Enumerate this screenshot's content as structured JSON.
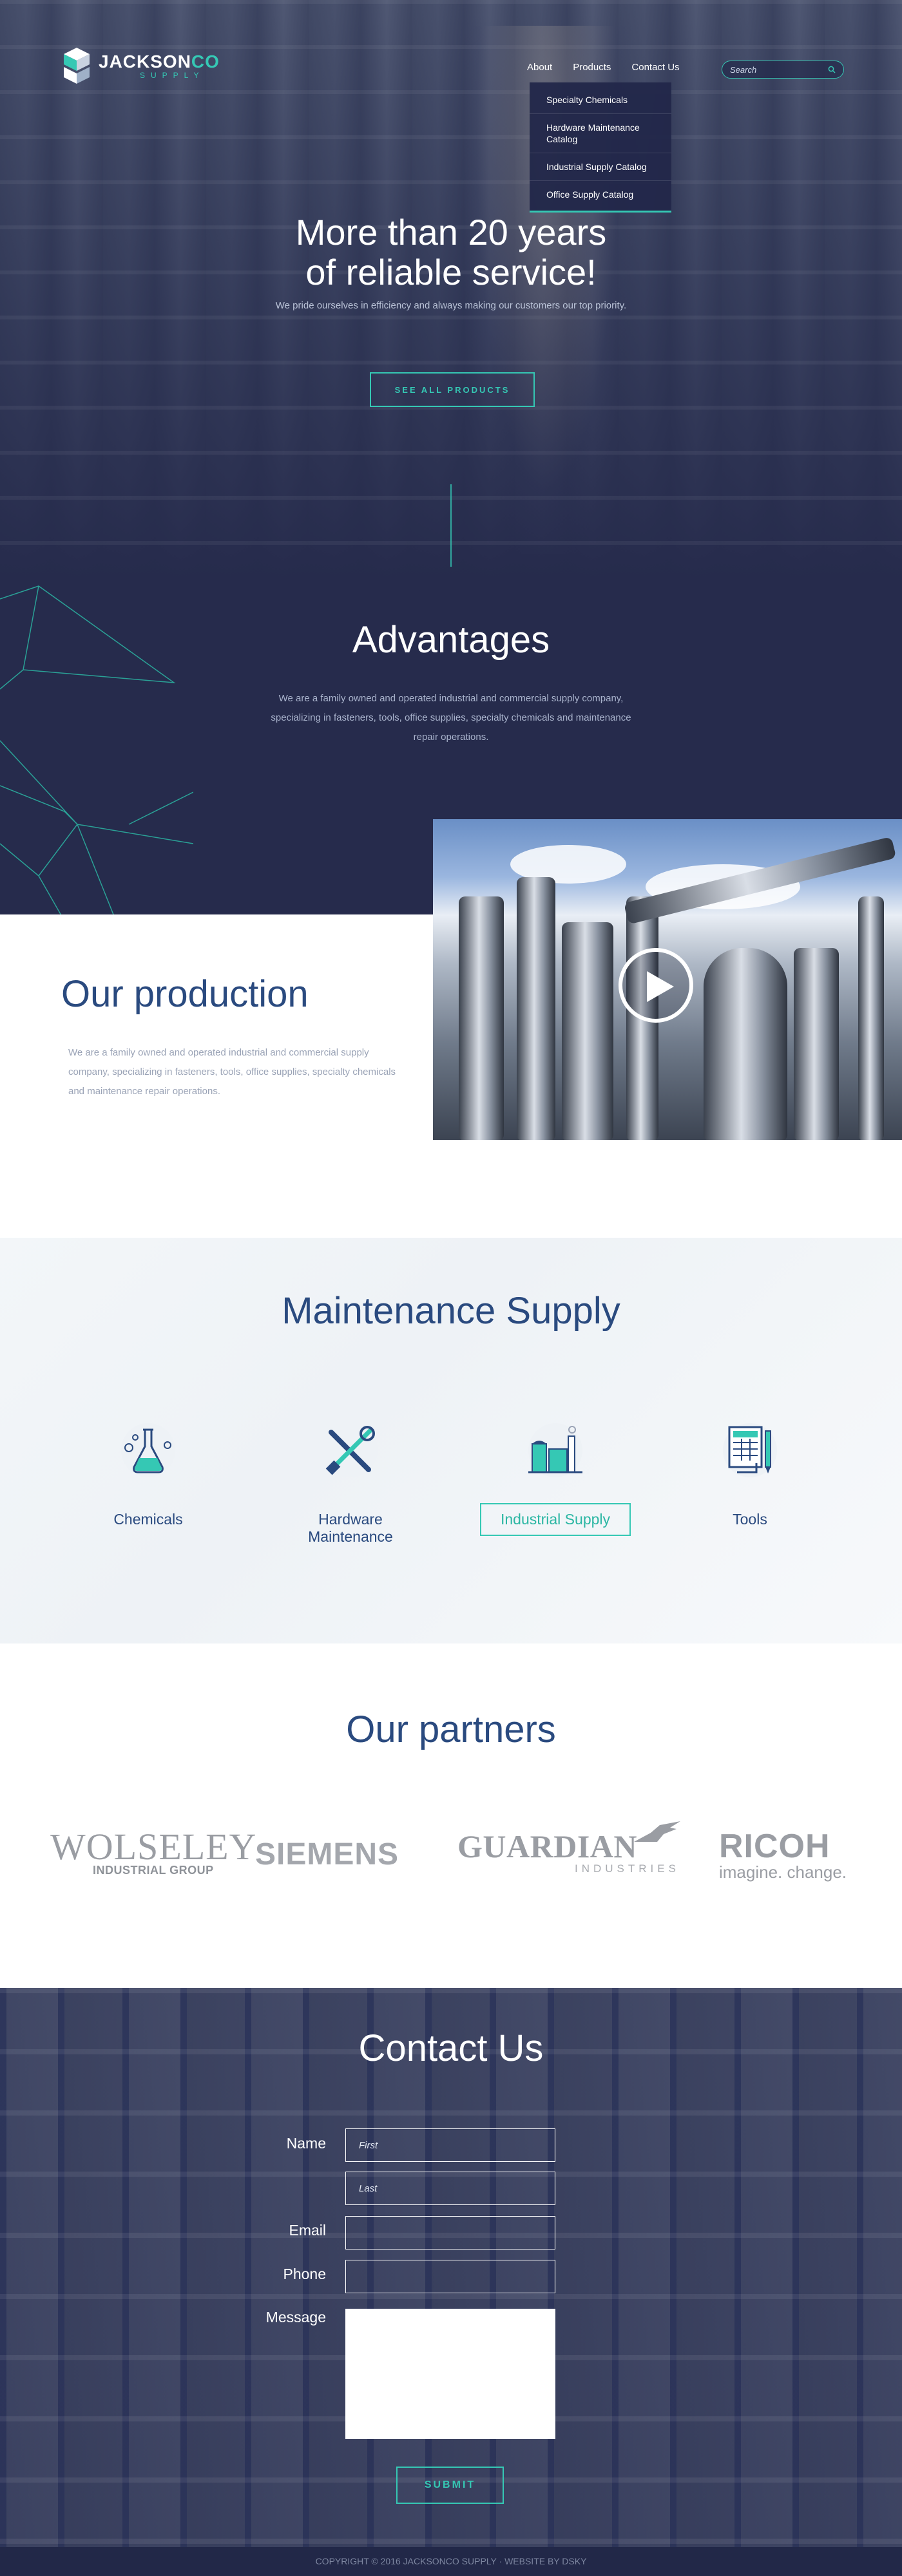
{
  "brand": {
    "name_main": "JACKSON",
    "name_accent": "CO",
    "sub": "SUPPLY"
  },
  "nav": {
    "items": [
      "About",
      "Products",
      "Contact Us"
    ],
    "search_placeholder": "Search"
  },
  "dropdown": {
    "items": [
      "Specialty Chemicals",
      "Hardware Maintenance Catalog",
      "Industrial Supply Catalog",
      "Office Supply Catalog"
    ]
  },
  "hero": {
    "title_line1": "More than 20 years",
    "title_line2": "of reliable service!",
    "subtitle": "We pride ourselves in efficiency and always making our customers our top priority.",
    "button": "SEE ALL PRODUCTS"
  },
  "advantages": {
    "title": "Advantages",
    "text": "We are a family owned and operated industrial and commercial supply company, specializing in fasteners, tools, office supplies, specialty chemicals and maintenance repair operations."
  },
  "production": {
    "title": "Our production",
    "text": "We are a family owned and operated industrial and commercial supply company, specializing in fasteners, tools, office supplies, specialty chemicals and maintenance repair operations."
  },
  "maintenance": {
    "title": "Maintenance Supply",
    "categories": [
      {
        "label": "Chemicals",
        "icon": "flask-icon"
      },
      {
        "label": "Hardware Maintenance",
        "icon": "tools-icon"
      },
      {
        "label": "Industrial Supply",
        "icon": "factory-icon"
      },
      {
        "label": "Tools",
        "icon": "blueprint-icon"
      }
    ],
    "active_index": 2
  },
  "partners": {
    "title": "Our partners",
    "logos": {
      "wolseley": "WOLSELEY",
      "wolseley_sub": "INDUSTRIAL GROUP",
      "siemens": "SIEMENS",
      "guardian": "GUARDIAN",
      "guardian_sub": "INDUSTRIES",
      "ricoh": "RICOH",
      "ricoh_sub": "imagine. change."
    }
  },
  "contact": {
    "title": "Contact Us",
    "name_label": "Name",
    "first_placeholder": "First",
    "last_placeholder": "Last",
    "email_label": "Email",
    "phone_label": "Phone",
    "message_label": "Message",
    "submit": "SUBMIT"
  },
  "footer": {
    "text": "COPYRIGHT © 2016 JACKSONCO SUPPLY · WEBSITE BY DSKY"
  },
  "colors": {
    "accent": "#35c8b4",
    "navy": "#262b4c",
    "heading_blue": "#2a4a7f"
  }
}
